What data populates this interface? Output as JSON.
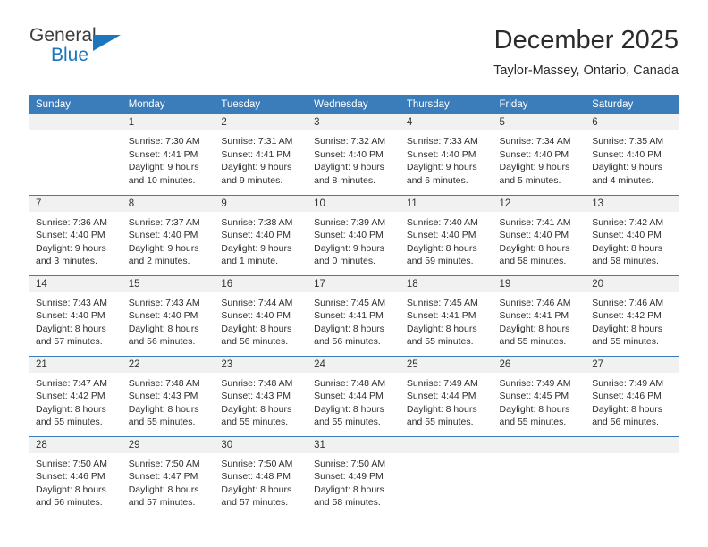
{
  "brand": {
    "name_part1": "General",
    "name_part2": "Blue",
    "logo_icon": "triangle-flag-icon"
  },
  "header": {
    "month_title": "December 2025",
    "location": "Taylor-Massey, Ontario, Canada"
  },
  "colors": {
    "header_blue": "#3a7dba",
    "brand_blue": "#1b76bd",
    "daynum_bg": "#f1f1f1",
    "text": "#2e2e2e"
  },
  "calendar": {
    "weekday_headers": [
      "Sunday",
      "Monday",
      "Tuesday",
      "Wednesday",
      "Thursday",
      "Friday",
      "Saturday"
    ],
    "weeks": [
      [
        {
          "day": "",
          "lines": []
        },
        {
          "day": "1",
          "lines": [
            "Sunrise: 7:30 AM",
            "Sunset: 4:41 PM",
            "Daylight: 9 hours",
            "and 10 minutes."
          ]
        },
        {
          "day": "2",
          "lines": [
            "Sunrise: 7:31 AM",
            "Sunset: 4:41 PM",
            "Daylight: 9 hours",
            "and 9 minutes."
          ]
        },
        {
          "day": "3",
          "lines": [
            "Sunrise: 7:32 AM",
            "Sunset: 4:40 PM",
            "Daylight: 9 hours",
            "and 8 minutes."
          ]
        },
        {
          "day": "4",
          "lines": [
            "Sunrise: 7:33 AM",
            "Sunset: 4:40 PM",
            "Daylight: 9 hours",
            "and 6 minutes."
          ]
        },
        {
          "day": "5",
          "lines": [
            "Sunrise: 7:34 AM",
            "Sunset: 4:40 PM",
            "Daylight: 9 hours",
            "and 5 minutes."
          ]
        },
        {
          "day": "6",
          "lines": [
            "Sunrise: 7:35 AM",
            "Sunset: 4:40 PM",
            "Daylight: 9 hours",
            "and 4 minutes."
          ]
        }
      ],
      [
        {
          "day": "7",
          "lines": [
            "Sunrise: 7:36 AM",
            "Sunset: 4:40 PM",
            "Daylight: 9 hours",
            "and 3 minutes."
          ]
        },
        {
          "day": "8",
          "lines": [
            "Sunrise: 7:37 AM",
            "Sunset: 4:40 PM",
            "Daylight: 9 hours",
            "and 2 minutes."
          ]
        },
        {
          "day": "9",
          "lines": [
            "Sunrise: 7:38 AM",
            "Sunset: 4:40 PM",
            "Daylight: 9 hours",
            "and 1 minute."
          ]
        },
        {
          "day": "10",
          "lines": [
            "Sunrise: 7:39 AM",
            "Sunset: 4:40 PM",
            "Daylight: 9 hours",
            "and 0 minutes."
          ]
        },
        {
          "day": "11",
          "lines": [
            "Sunrise: 7:40 AM",
            "Sunset: 4:40 PM",
            "Daylight: 8 hours",
            "and 59 minutes."
          ]
        },
        {
          "day": "12",
          "lines": [
            "Sunrise: 7:41 AM",
            "Sunset: 4:40 PM",
            "Daylight: 8 hours",
            "and 58 minutes."
          ]
        },
        {
          "day": "13",
          "lines": [
            "Sunrise: 7:42 AM",
            "Sunset: 4:40 PM",
            "Daylight: 8 hours",
            "and 58 minutes."
          ]
        }
      ],
      [
        {
          "day": "14",
          "lines": [
            "Sunrise: 7:43 AM",
            "Sunset: 4:40 PM",
            "Daylight: 8 hours",
            "and 57 minutes."
          ]
        },
        {
          "day": "15",
          "lines": [
            "Sunrise: 7:43 AM",
            "Sunset: 4:40 PM",
            "Daylight: 8 hours",
            "and 56 minutes."
          ]
        },
        {
          "day": "16",
          "lines": [
            "Sunrise: 7:44 AM",
            "Sunset: 4:40 PM",
            "Daylight: 8 hours",
            "and 56 minutes."
          ]
        },
        {
          "day": "17",
          "lines": [
            "Sunrise: 7:45 AM",
            "Sunset: 4:41 PM",
            "Daylight: 8 hours",
            "and 56 minutes."
          ]
        },
        {
          "day": "18",
          "lines": [
            "Sunrise: 7:45 AM",
            "Sunset: 4:41 PM",
            "Daylight: 8 hours",
            "and 55 minutes."
          ]
        },
        {
          "day": "19",
          "lines": [
            "Sunrise: 7:46 AM",
            "Sunset: 4:41 PM",
            "Daylight: 8 hours",
            "and 55 minutes."
          ]
        },
        {
          "day": "20",
          "lines": [
            "Sunrise: 7:46 AM",
            "Sunset: 4:42 PM",
            "Daylight: 8 hours",
            "and 55 minutes."
          ]
        }
      ],
      [
        {
          "day": "21",
          "lines": [
            "Sunrise: 7:47 AM",
            "Sunset: 4:42 PM",
            "Daylight: 8 hours",
            "and 55 minutes."
          ]
        },
        {
          "day": "22",
          "lines": [
            "Sunrise: 7:48 AM",
            "Sunset: 4:43 PM",
            "Daylight: 8 hours",
            "and 55 minutes."
          ]
        },
        {
          "day": "23",
          "lines": [
            "Sunrise: 7:48 AM",
            "Sunset: 4:43 PM",
            "Daylight: 8 hours",
            "and 55 minutes."
          ]
        },
        {
          "day": "24",
          "lines": [
            "Sunrise: 7:48 AM",
            "Sunset: 4:44 PM",
            "Daylight: 8 hours",
            "and 55 minutes."
          ]
        },
        {
          "day": "25",
          "lines": [
            "Sunrise: 7:49 AM",
            "Sunset: 4:44 PM",
            "Daylight: 8 hours",
            "and 55 minutes."
          ]
        },
        {
          "day": "26",
          "lines": [
            "Sunrise: 7:49 AM",
            "Sunset: 4:45 PM",
            "Daylight: 8 hours",
            "and 55 minutes."
          ]
        },
        {
          "day": "27",
          "lines": [
            "Sunrise: 7:49 AM",
            "Sunset: 4:46 PM",
            "Daylight: 8 hours",
            "and 56 minutes."
          ]
        }
      ],
      [
        {
          "day": "28",
          "lines": [
            "Sunrise: 7:50 AM",
            "Sunset: 4:46 PM",
            "Daylight: 8 hours",
            "and 56 minutes."
          ]
        },
        {
          "day": "29",
          "lines": [
            "Sunrise: 7:50 AM",
            "Sunset: 4:47 PM",
            "Daylight: 8 hours",
            "and 57 minutes."
          ]
        },
        {
          "day": "30",
          "lines": [
            "Sunrise: 7:50 AM",
            "Sunset: 4:48 PM",
            "Daylight: 8 hours",
            "and 57 minutes."
          ]
        },
        {
          "day": "31",
          "lines": [
            "Sunrise: 7:50 AM",
            "Sunset: 4:49 PM",
            "Daylight: 8 hours",
            "and 58 minutes."
          ]
        },
        {
          "day": "",
          "lines": []
        },
        {
          "day": "",
          "lines": []
        },
        {
          "day": "",
          "lines": []
        }
      ]
    ]
  }
}
